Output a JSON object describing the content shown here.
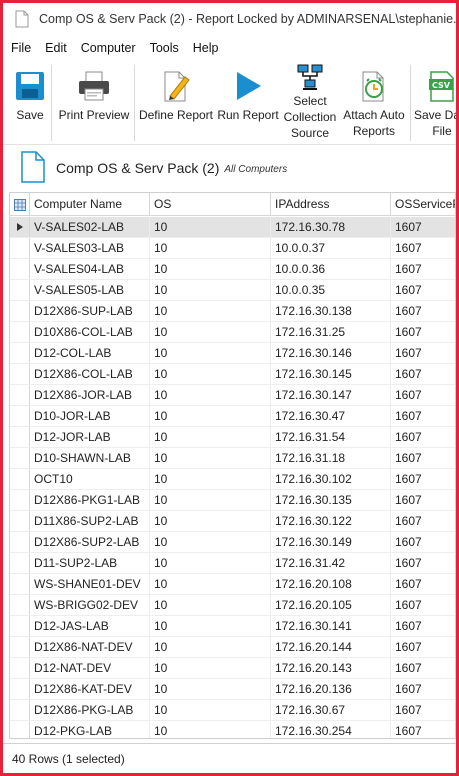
{
  "window": {
    "title": "Comp OS & Serv Pack (2) - Report Locked by ADMINARSENAL\\stephanie.warner"
  },
  "menu": [
    "File",
    "Edit",
    "Computer",
    "Tools",
    "Help"
  ],
  "toolbar": {
    "save": "Save",
    "print_preview": "Print Preview",
    "define_report": "Define Report",
    "run_report": "Run Report",
    "select_collection_source": "Select\nCollection\nSource",
    "attach_auto_reports": "Attach Auto\nReports",
    "save_data_file": "Save Data\nFile",
    "csv_badge": "CSV"
  },
  "report": {
    "title": "Comp OS & Serv Pack (2)",
    "subtitle": "All Computers"
  },
  "columns": [
    "Computer Name",
    "OS",
    "IPAddress",
    "OSServicePack"
  ],
  "rows": [
    [
      "V-SALES02-LAB",
      "10",
      "172.16.30.78",
      "1607"
    ],
    [
      "V-SALES03-LAB",
      "10",
      "10.0.0.37",
      "1607"
    ],
    [
      "V-SALES04-LAB",
      "10",
      "10.0.0.36",
      "1607"
    ],
    [
      "V-SALES05-LAB",
      "10",
      "10.0.0.35",
      "1607"
    ],
    [
      "D12X86-SUP-LAB",
      "10",
      "172.16.30.138",
      "1607"
    ],
    [
      "D10X86-COL-LAB",
      "10",
      "172.16.31.25",
      "1607"
    ],
    [
      "D12-COL-LAB",
      "10",
      "172.16.30.146",
      "1607"
    ],
    [
      "D12X86-COL-LAB",
      "10",
      "172.16.30.145",
      "1607"
    ],
    [
      "D12X86-JOR-LAB",
      "10",
      "172.16.30.147",
      "1607"
    ],
    [
      "D10-JOR-LAB",
      "10",
      "172.16.30.47",
      "1607"
    ],
    [
      "D12-JOR-LAB",
      "10",
      "172.16.31.54",
      "1607"
    ],
    [
      "D10-SHAWN-LAB",
      "10",
      "172.16.31.18",
      "1607"
    ],
    [
      "OCT10",
      "10",
      "172.16.30.102",
      "1607"
    ],
    [
      "D12X86-PKG1-LAB",
      "10",
      "172.16.30.135",
      "1607"
    ],
    [
      "D11X86-SUP2-LAB",
      "10",
      "172.16.30.122",
      "1607"
    ],
    [
      "D12X86-SUP2-LAB",
      "10",
      "172.16.30.149",
      "1607"
    ],
    [
      "D11-SUP2-LAB",
      "10",
      "172.16.31.42",
      "1607"
    ],
    [
      "WS-SHANE01-DEV",
      "10",
      "172.16.20.108",
      "1607"
    ],
    [
      "WS-BRIGG02-DEV",
      "10",
      "172.16.20.105",
      "1607"
    ],
    [
      "D12-JAS-LAB",
      "10",
      "172.16.30.141",
      "1607"
    ],
    [
      "D12X86-NAT-DEV",
      "10",
      "172.16.20.144",
      "1607"
    ],
    [
      "D12-NAT-DEV",
      "10",
      "172.16.20.143",
      "1607"
    ],
    [
      "D12X86-KAT-DEV",
      "10",
      "172.16.20.136",
      "1607"
    ],
    [
      "D12X86-PKG-LAB",
      "10",
      "172.16.30.67",
      "1607"
    ],
    [
      "D12-PKG-LAB",
      "10",
      "172.16.30.254",
      "1607"
    ]
  ],
  "status": "40 Rows (1 selected)",
  "colors": {
    "border": "#e8203a",
    "accent_blue": "#1a8fd0",
    "selected_row": "#e3e3e3"
  },
  "icons": {
    "save": "floppy-disk-icon",
    "print_preview": "printer-icon",
    "define_report": "pencil-document-icon",
    "run_report": "play-icon",
    "select_collection_source": "network-computers-icon",
    "attach_auto_reports": "alarm-clock-document-icon",
    "save_data_file": "csv-file-icon"
  }
}
